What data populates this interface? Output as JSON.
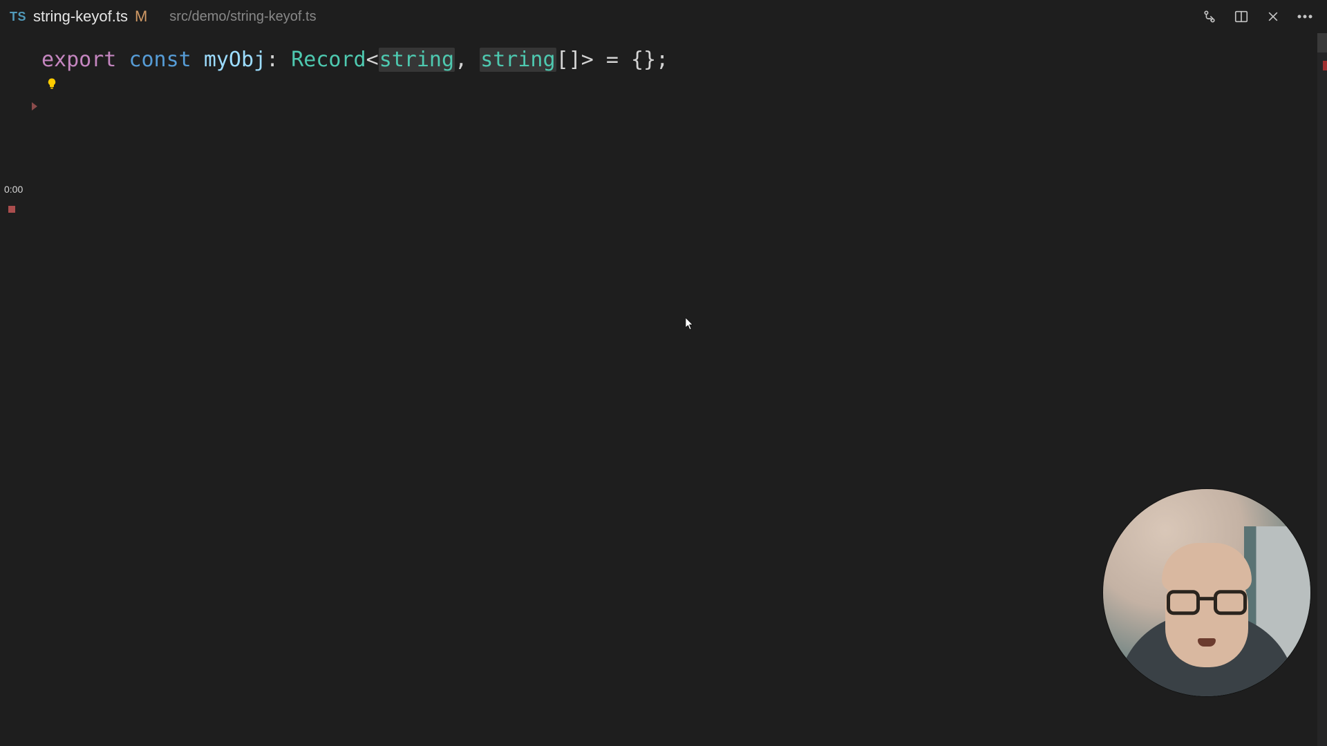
{
  "tab": {
    "lang_badge": "TS",
    "filename": "string-keyof.ts",
    "modified_indicator": "M",
    "breadcrumb": "src/demo/string-keyof.ts"
  },
  "code": {
    "t_export": "export",
    "t_const": "const",
    "t_var": "myObj",
    "t_colon": ":",
    "t_record": "Record",
    "t_lt": "<",
    "t_string1": "string",
    "t_comma": ",",
    "t_string2": "string",
    "t_brack": "[]",
    "t_gt": ">",
    "t_eq": "=",
    "t_braces": "{}",
    "t_semi": ";"
  },
  "recording": {
    "timestamp": "0:00"
  },
  "colors": {
    "bg": "#1e1e1e",
    "keyword": "#c586c0",
    "storage": "#569cd6",
    "identifier": "#9cdcfe",
    "type": "#4ec9b0",
    "punct": "#d4d4d4",
    "bulb": "#ffcc00",
    "modified": "#d19a66"
  }
}
